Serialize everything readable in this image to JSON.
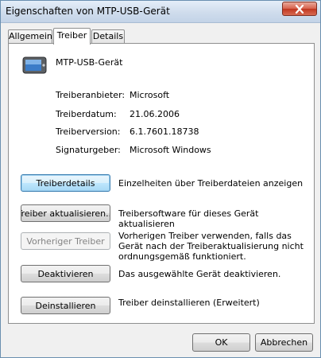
{
  "window": {
    "title": "Eigenschaften von MTP-USB-Gerät"
  },
  "tabs": [
    {
      "label": "Allgemein"
    },
    {
      "label": "Treiber"
    },
    {
      "label": "Details"
    }
  ],
  "device": {
    "name": "MTP-USB-Gerät",
    "icon": "device-icon"
  },
  "info": [
    {
      "label": "Treiberanbieter:",
      "value": "Microsoft"
    },
    {
      "label": "Treiberdatum:",
      "value": "21.06.2006"
    },
    {
      "label": "Treiberversion:",
      "value": "6.1.7601.18738"
    },
    {
      "label": "Signaturgeber:",
      "value": "Microsoft Windows"
    }
  ],
  "actions": [
    {
      "label": "Treiberdetails",
      "desc": "Einzelheiten über Treiberdateien anzeigen"
    },
    {
      "label": "Treiber aktualisieren...",
      "desc": "Treibersoftware für dieses Gerät aktualisieren"
    },
    {
      "label": "Vorheriger Treiber",
      "desc": "Vorherigen Treiber verwenden, falls das Gerät nach der Treiberaktualisierung nicht ordnungsgemäß funktioniert."
    },
    {
      "label": "Deaktivieren",
      "desc": "Das ausgewählte Gerät deaktivieren."
    },
    {
      "label": "Deinstallieren",
      "desc": "Treiber deinstallieren (Erweitert)"
    }
  ],
  "footer": {
    "ok_label": "OK",
    "cancel_label": "Abbrechen"
  },
  "colors": {
    "accent": "#3c7fb1",
    "close": "#c0361f"
  }
}
